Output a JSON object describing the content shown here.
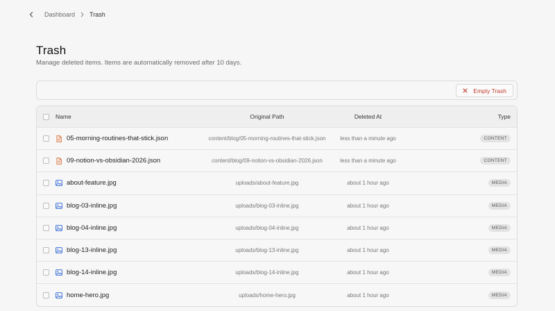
{
  "breadcrumb": {
    "parent": "Dashboard",
    "current": "Trash"
  },
  "page": {
    "title": "Trash",
    "subtitle": "Manage deleted items. Items are automatically removed after 10 days."
  },
  "toolbar": {
    "empty_label": "Empty Trash"
  },
  "table": {
    "headers": {
      "name": "Name",
      "path": "Original Path",
      "deleted": "Deleted At",
      "type": "Type"
    },
    "rows": [
      {
        "icon": "file-icon",
        "name": "05-morning-routines-that-stick.json",
        "path": "content/blog/05-morning-routines-that-stick.json",
        "deleted": "less than a minute ago",
        "type": "CONTENT"
      },
      {
        "icon": "file-icon",
        "name": "09-notion-vs-obsidian-2026.json",
        "path": "content/blog/09-notion-vs-obsidian-2026.json",
        "deleted": "less than a minute ago",
        "type": "CONTENT"
      },
      {
        "icon": "image-icon",
        "name": "about-feature.jpg",
        "path": "uploads/about-feature.jpg",
        "deleted": "about 1 hour ago",
        "type": "MEDIA"
      },
      {
        "icon": "image-icon",
        "name": "blog-03-inline.jpg",
        "path": "uploads/blog-03-inline.jpg",
        "deleted": "about 1 hour ago",
        "type": "MEDIA"
      },
      {
        "icon": "image-icon",
        "name": "blog-04-inline.jpg",
        "path": "uploads/blog-04-inline.jpg",
        "deleted": "about 1 hour ago",
        "type": "MEDIA"
      },
      {
        "icon": "image-icon",
        "name": "blog-13-inline.jpg",
        "path": "uploads/blog-13-inline.jpg",
        "deleted": "about 1 hour ago",
        "type": "MEDIA"
      },
      {
        "icon": "image-icon",
        "name": "blog-14-inline.jpg",
        "path": "uploads/blog-14-inline.jpg",
        "deleted": "about 1 hour ago",
        "type": "MEDIA"
      },
      {
        "icon": "image-icon",
        "name": "home-hero.jpg",
        "path": "uploads/home-hero.jpg",
        "deleted": "about 1 hour ago",
        "type": "MEDIA"
      }
    ]
  },
  "colors": {
    "file_icon": "#d9773f",
    "image_icon": "#3b6fd8",
    "danger": "#c0392b"
  }
}
